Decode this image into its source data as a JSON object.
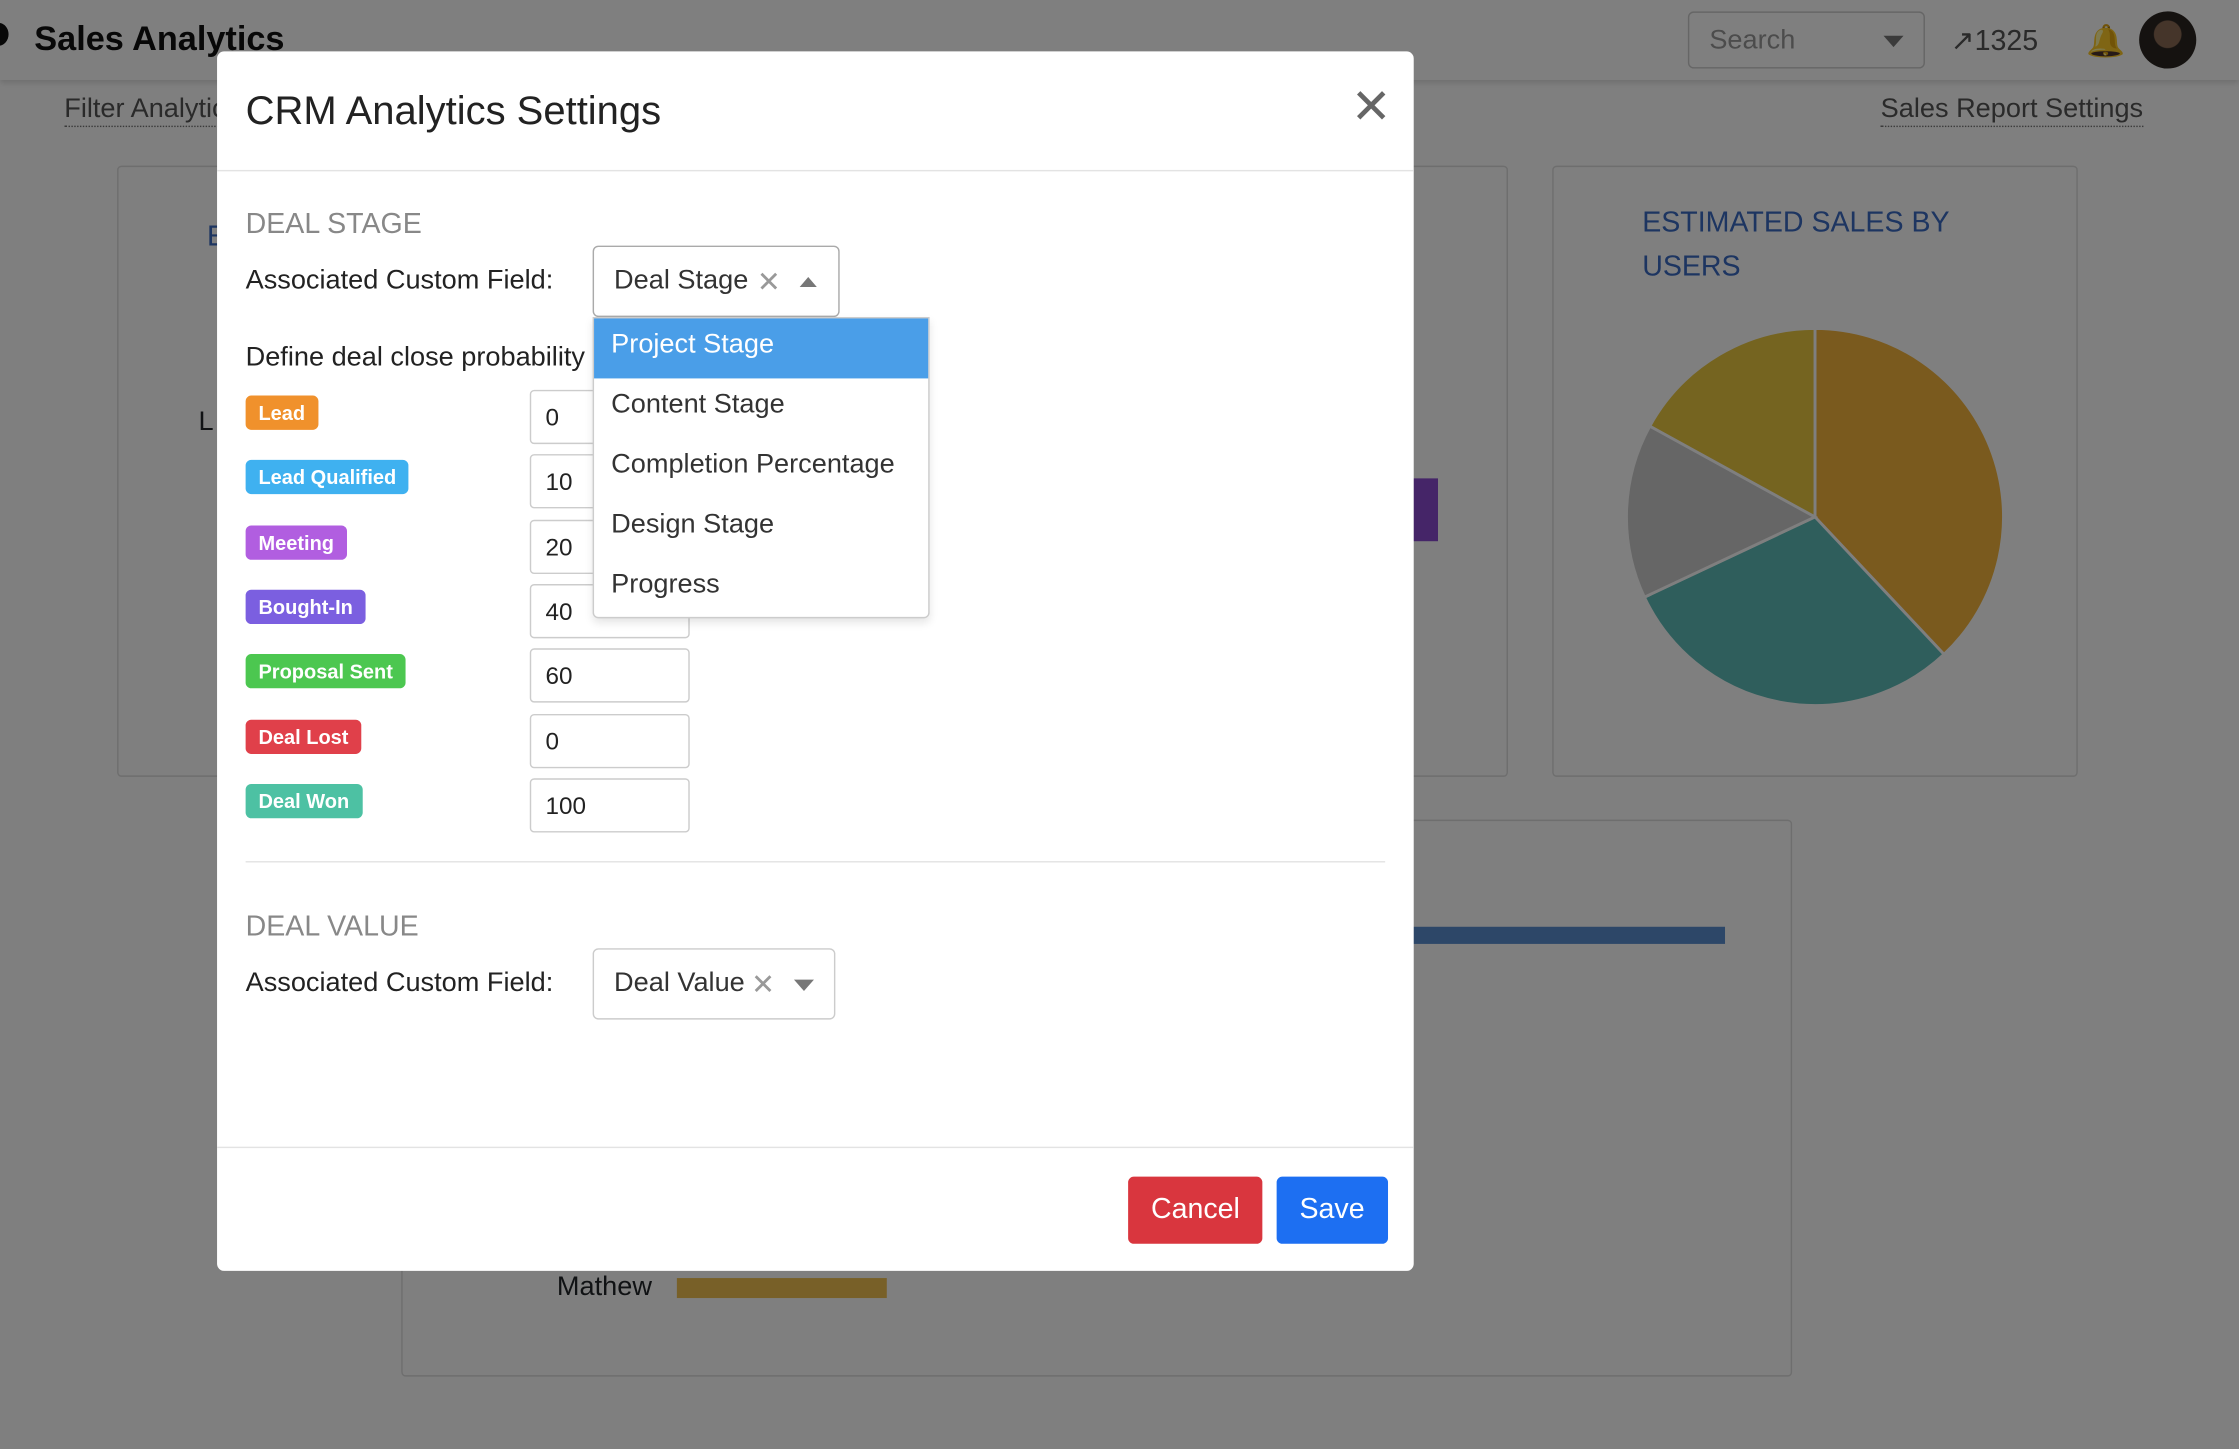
{
  "header": {
    "title": "Sales Analytics",
    "search_placeholder": "Search",
    "count": "1325"
  },
  "links": {
    "filter": "Filter Analytics",
    "report_settings": "Sales Report Settings"
  },
  "background": {
    "left_card_title_fragment": "E",
    "left_card_label_fragment": "L",
    "bottom_card_label": "Mathew",
    "pie_title": "ESTIMATED SALES BY USERS"
  },
  "pie_colors": [
    "#f4b43c",
    "#5ebcb8",
    "#cccccc",
    "#eac840"
  ],
  "pie_fractions": [
    0.38,
    0.3,
    0.15,
    0.17
  ],
  "modal": {
    "title": "CRM Analytics Settings",
    "deal_stage": {
      "heading": "DEAL STAGE",
      "field_label": "Associated Custom Field:",
      "selected": "Deal Stage",
      "probability_label": "Define deal close probability",
      "dropdown_options": [
        {
          "label": "Project Stage",
          "active": true
        },
        {
          "label": "Content Stage"
        },
        {
          "label": "Completion Percentage"
        },
        {
          "label": "Design Stage"
        },
        {
          "label": "Progress"
        }
      ],
      "stages": [
        {
          "label": "Lead",
          "value": "0",
          "color": "#f0912c"
        },
        {
          "label": "Lead Qualified",
          "value": "10",
          "color": "#3fb1f0"
        },
        {
          "label": "Meeting",
          "value": "20",
          "color": "#b15ee0"
        },
        {
          "label": "Bought-In",
          "value": "40",
          "color": "#7b5fe0"
        },
        {
          "label": "Proposal Sent",
          "value": "60",
          "color": "#4cc750"
        },
        {
          "label": "Deal Lost",
          "value": "0",
          "color": "#e0404a"
        },
        {
          "label": "Deal Won",
          "value": "100",
          "color": "#4dc1a3"
        }
      ]
    },
    "deal_value": {
      "heading": "DEAL VALUE",
      "field_label": "Associated Custom Field:",
      "selected": "Deal Value"
    },
    "cancel": "Cancel",
    "save": "Save"
  }
}
